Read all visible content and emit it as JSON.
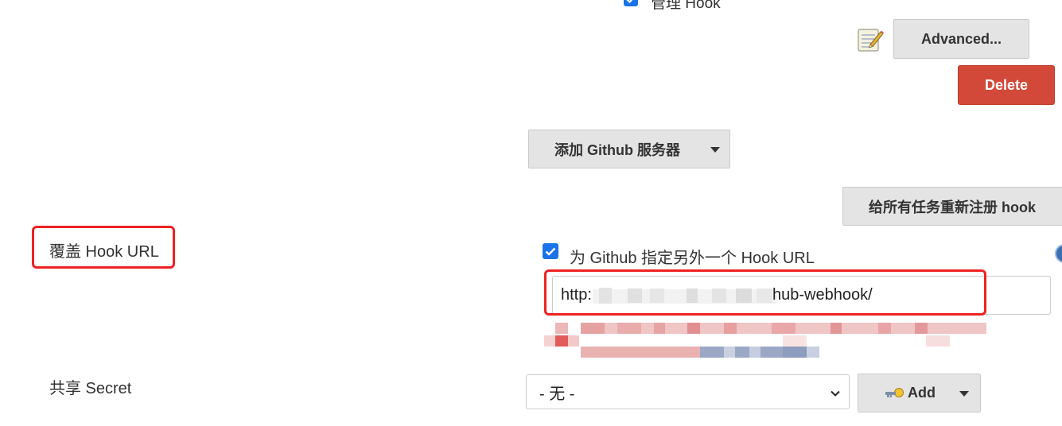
{
  "top": {
    "partial_label": "管理 Hook"
  },
  "server_actions": {
    "advanced_label": "Advanced...",
    "delete_label": "Delete",
    "add_server_label": "添加 Github 服务器"
  },
  "reregister_label": "给所有任务重新注册 hook",
  "override": {
    "field_label": "覆盖 Hook URL",
    "checkbox_label": "为 Github 指定另外一个 Hook URL",
    "checked": true,
    "url_prefix": "http:",
    "url_suffix": "hub-webhook/"
  },
  "secret": {
    "field_label": "共享 Secret",
    "select_value": "- 无 -",
    "add_label": "Add"
  },
  "icons": {
    "notepad": "notepad-icon",
    "key": "key-icon",
    "help": "help-icon"
  },
  "colors": {
    "accent": "#1a73e8",
    "danger": "#d24939",
    "highlight": "#ee2222"
  }
}
